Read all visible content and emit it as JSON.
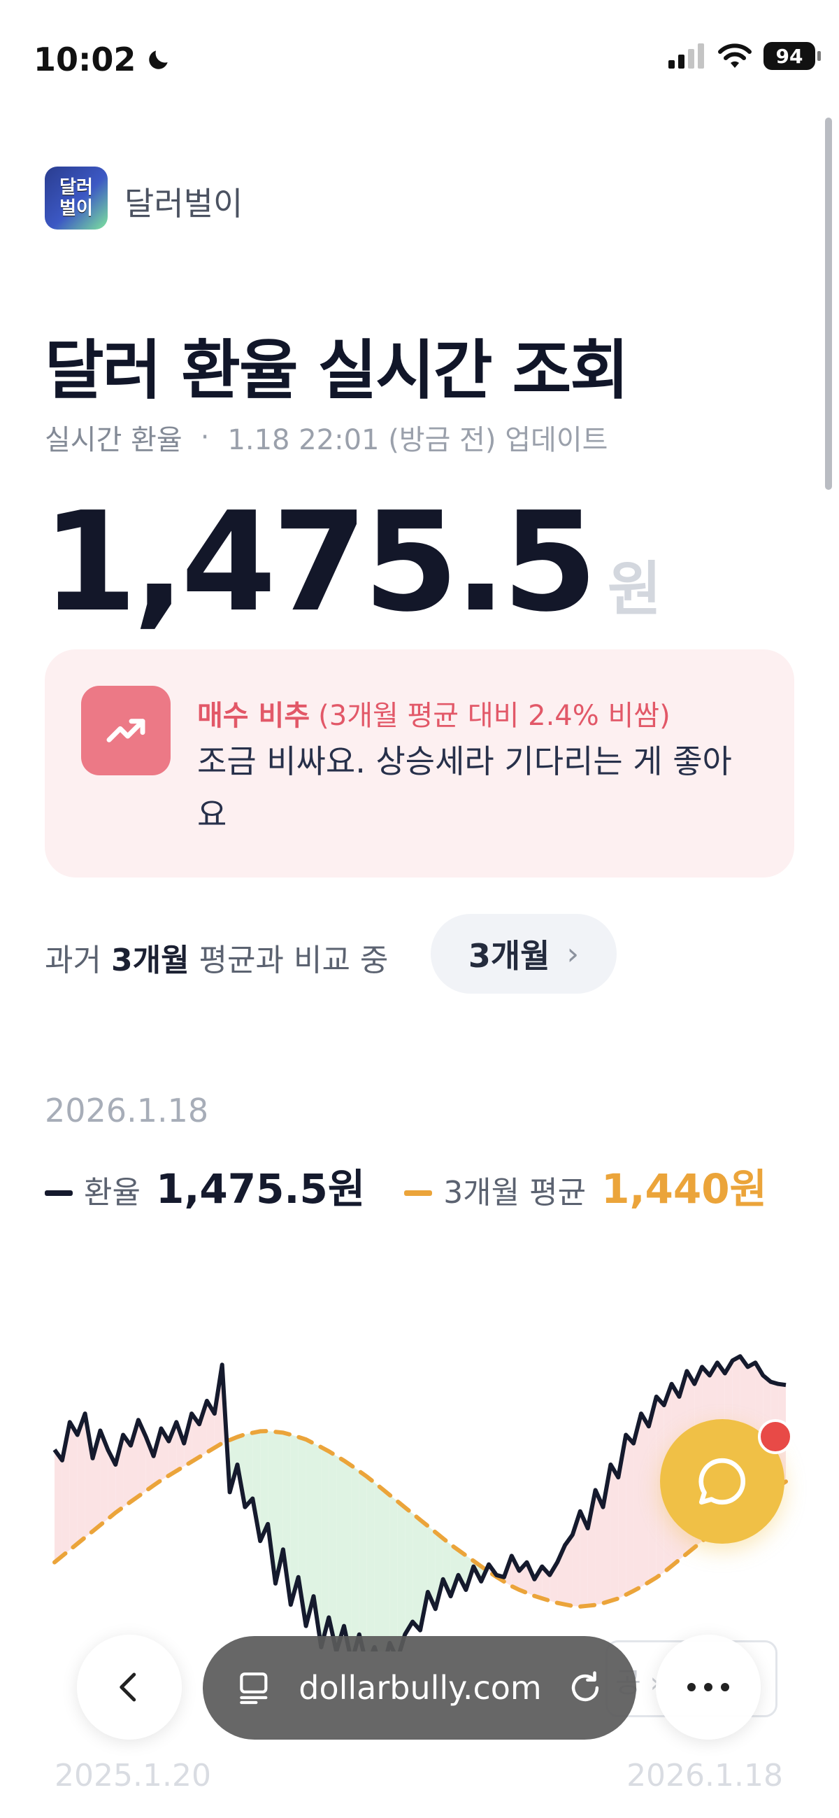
{
  "status_bar": {
    "time": "10:02",
    "battery": "94",
    "icons": [
      "moon-icon",
      "signal-icon",
      "wifi-icon",
      "battery-icon"
    ]
  },
  "brand": {
    "logo_line1": "달러",
    "logo_line2": "벌이",
    "name": "달러벌이"
  },
  "page": {
    "title": "달러 환율 실시간 조회"
  },
  "update": {
    "label": "실시간 환율",
    "separator": "·",
    "time": "1.18 22:01 (방금 전) 업데이트"
  },
  "rate": {
    "value": "1,475.5",
    "unit": "원"
  },
  "advice": {
    "status": "매수 비추",
    "detail": "(3개월 평균 대비 2.4% 비쌈)",
    "message": "조금 비싸요. 상승세라 기다리는 게 좋아요",
    "icon": "trending-up-icon",
    "accent": "#e25868"
  },
  "compare": {
    "prefix": "과거",
    "period": "3개월",
    "suffix": "평균과 비교 중",
    "button_label": "3개월",
    "button_chevron": "›"
  },
  "chart_header": {
    "date": "2026.1.18",
    "rate_label": "환율",
    "rate_value": "1,475.5원",
    "avg_label": "3개월 평균",
    "avg_value": "1,440원",
    "rate_color": "#151a2d",
    "avg_color": "#eba43a"
  },
  "chart_data": {
    "type": "line",
    "x_start": "2025.1.20",
    "x_end": "2026.1.18",
    "ylim": [
      1350,
      1495
    ],
    "grid": false,
    "series": [
      {
        "name": "환율",
        "color": "#151a2d",
        "values": [
          1445,
          1440,
          1458,
          1452,
          1462,
          1441,
          1454,
          1445,
          1438,
          1452,
          1447,
          1459,
          1451,
          1442,
          1455,
          1449,
          1458,
          1448,
          1462,
          1457,
          1468,
          1462,
          1485,
          1425,
          1438,
          1418,
          1422,
          1402,
          1410,
          1382,
          1398,
          1372,
          1385,
          1362,
          1376,
          1352,
          1366,
          1350,
          1362,
          1345,
          1358,
          1343,
          1352,
          1340,
          1354,
          1346,
          1358,
          1364,
          1360,
          1378,
          1370,
          1384,
          1376,
          1386,
          1379,
          1390,
          1383,
          1391,
          1386,
          1385,
          1395,
          1388,
          1392,
          1384,
          1390,
          1386,
          1392,
          1400,
          1405,
          1416,
          1408,
          1426,
          1418,
          1438,
          1432,
          1452,
          1448,
          1462,
          1456,
          1470,
          1466,
          1476,
          1470,
          1482,
          1476,
          1484,
          1480,
          1486,
          1481,
          1487,
          1489,
          1484,
          1486,
          1480,
          1477,
          1476,
          1475.5
        ]
      },
      {
        "name": "3개월 평균",
        "color": "#eba43a",
        "style": "dashed",
        "values": [
          1392,
          1400,
          1408,
          1416,
          1423,
          1430,
          1436,
          1442,
          1448,
          1452,
          1454,
          1453,
          1450,
          1445,
          1439,
          1432,
          1424,
          1416,
          1408,
          1400,
          1393,
          1386,
          1380,
          1376,
          1373,
          1371,
          1372,
          1375,
          1380,
          1386,
          1394,
          1402,
          1410,
          1418,
          1424,
          1430
        ]
      }
    ]
  },
  "chat": {
    "icon": "chat-bubble-icon"
  },
  "browser": {
    "url": "dollarbully.com",
    "partial_chip_text": "공 ›"
  }
}
